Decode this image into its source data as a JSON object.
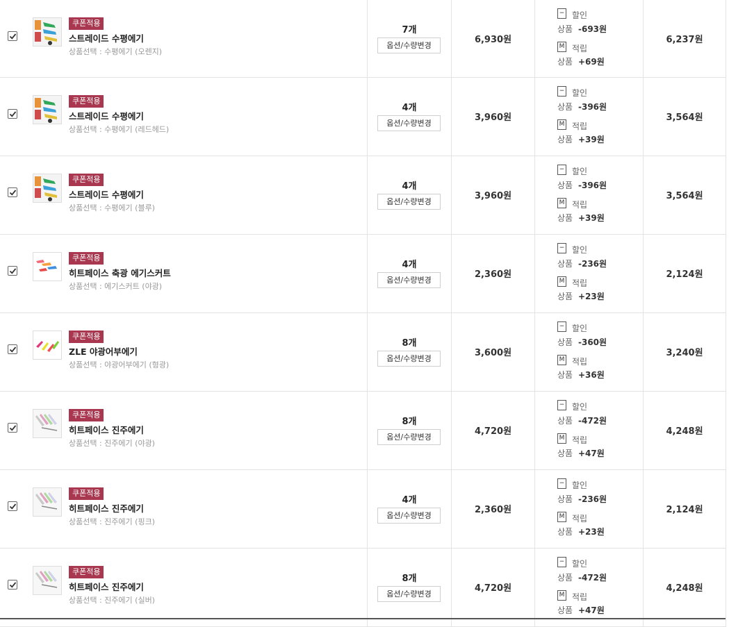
{
  "badge_label": "쿠폰적용",
  "option_button_label": "옵션/수량변경",
  "discount_label": "할인",
  "points_label": "적립",
  "product_label": "상품",
  "discount_icon": "−",
  "points_icon": "M",
  "rows": [
    {
      "name": "스트레이드 수평에기",
      "option": "상품선택 : 수평에기 (오렌지)",
      "qty": "7개",
      "price": "6,930원",
      "discount": "-693원",
      "points": "+69원",
      "total": "6,237원",
      "thumb": "egi-photo"
    },
    {
      "name": "스트레이드 수평에기",
      "option": "상품선택 : 수평에기 (레드헤드)",
      "qty": "4개",
      "price": "3,960원",
      "discount": "-396원",
      "points": "+39원",
      "total": "3,564원",
      "thumb": "egi-photo"
    },
    {
      "name": "스트레이드 수평에기",
      "option": "상품선택 : 수평에기 (블루)",
      "qty": "4개",
      "price": "3,960원",
      "discount": "-396원",
      "points": "+39원",
      "total": "3,564원",
      "thumb": "egi-photo"
    },
    {
      "name": "히트페이스 축광 에기스커트",
      "option": "상품선택 : 에기스커트 (야광)",
      "qty": "4개",
      "price": "2,360원",
      "discount": "-236원",
      "points": "+23원",
      "total": "2,124원",
      "thumb": "skirt"
    },
    {
      "name": "ZLE 야광어부에기",
      "option": "상품선택 : 야광어부에기 (형광)",
      "qty": "8개",
      "price": "3,600원",
      "discount": "-360원",
      "points": "+36원",
      "total": "3,240원",
      "thumb": "fisher"
    },
    {
      "name": "히트페이스 진주에기",
      "option": "상품선택 : 진주에기 (야광)",
      "qty": "8개",
      "price": "4,720원",
      "discount": "-472원",
      "points": "+47원",
      "total": "4,248원",
      "thumb": "pearl"
    },
    {
      "name": "히트페이스 진주에기",
      "option": "상품선택 : 진주에기 (핑크)",
      "qty": "4개",
      "price": "2,360원",
      "discount": "-236원",
      "points": "+23원",
      "total": "2,124원",
      "thumb": "pearl"
    },
    {
      "name": "히트페이스 진주에기",
      "option": "상품선택 : 진주에기 (실버)",
      "qty": "8개",
      "price": "4,720원",
      "discount": "-472원",
      "points": "+47원",
      "total": "4,248원",
      "thumb": "pearl"
    }
  ]
}
